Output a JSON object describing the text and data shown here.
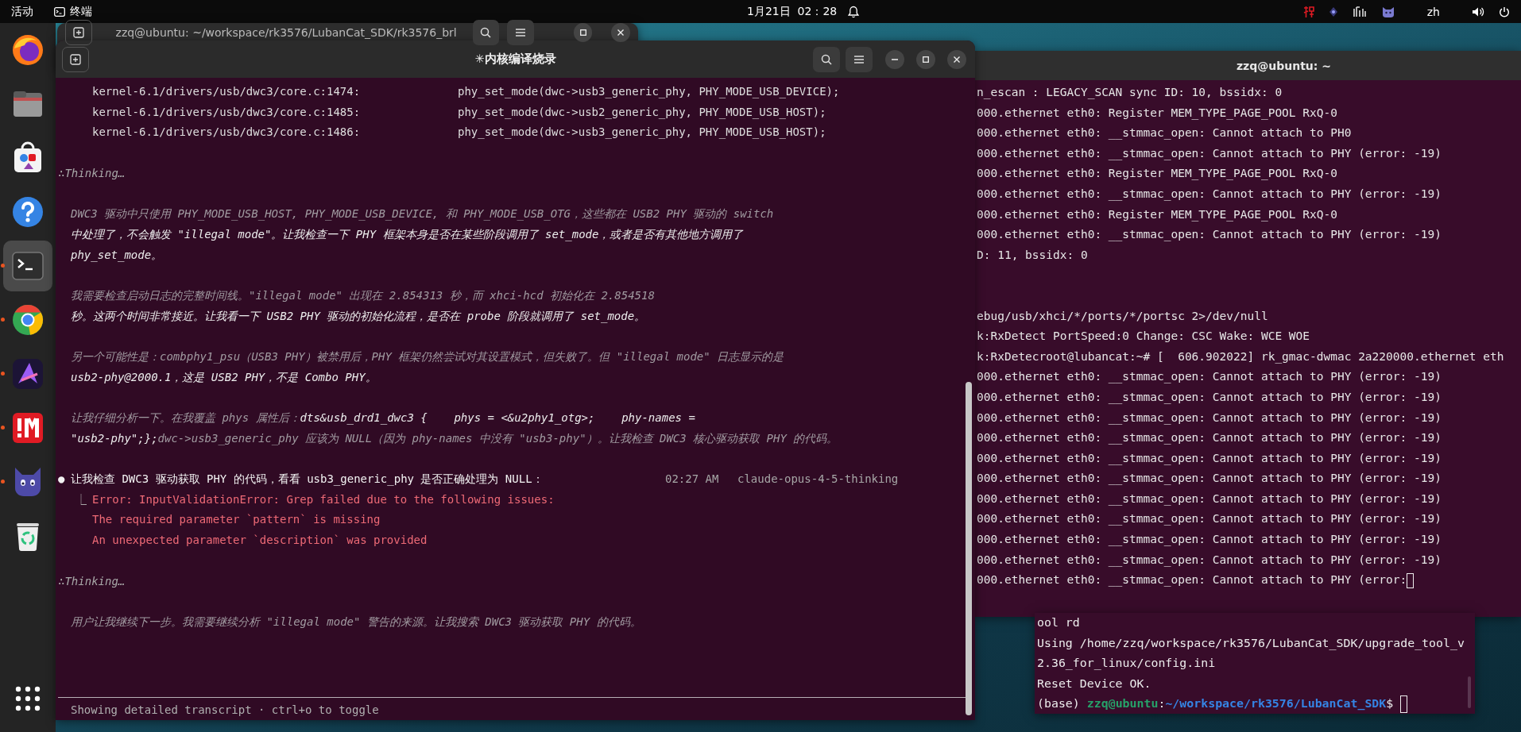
{
  "top_bar": {
    "activities": "活动",
    "app_name": "终端",
    "clock": "1月21日  02：28",
    "language": "zh"
  },
  "dock": {
    "items": [
      {
        "kind": "firefox",
        "running": false,
        "selected": false
      },
      {
        "kind": "files",
        "running": false,
        "selected": false
      },
      {
        "kind": "software",
        "running": false,
        "selected": false
      },
      {
        "kind": "help",
        "running": false,
        "selected": false
      },
      {
        "kind": "terminal",
        "running": true,
        "selected": true
      },
      {
        "kind": "chrome",
        "running": true,
        "selected": false
      },
      {
        "kind": "arrow_app",
        "running": true,
        "selected": false
      },
      {
        "kind": "bang_app",
        "running": true,
        "selected": false
      },
      {
        "kind": "cat",
        "running": true,
        "selected": false
      },
      {
        "kind": "trash",
        "running": false,
        "selected": false
      },
      {
        "kind": "grid",
        "running": false,
        "selected": false
      }
    ]
  },
  "back_window": {
    "title": "zzq@ubuntu: ~/workspace/rk3576/LubanCat_SDK/rk3576_brl"
  },
  "main_window": {
    "title": "✳内核编译烧录",
    "transcript": [
      {
        "kind": "code",
        "path": "kernel-6.1/drivers/usb/dwc3/core.c:1474:",
        "call": "phy_set_mode(dwc->usb3_generic_phy, PHY_MODE_USB_DEVICE);"
      },
      {
        "kind": "code",
        "path": "kernel-6.1/drivers/usb/dwc3/core.c:1485:",
        "call": "phy_set_mode(dwc->usb2_generic_phy, PHY_MODE_USB_HOST);"
      },
      {
        "kind": "code",
        "path": "kernel-6.1/drivers/usb/dwc3/core.c:1486:",
        "call": "phy_set_mode(dwc->usb3_generic_phy, PHY_MODE_USB_HOST);"
      },
      {
        "kind": "thinking",
        "text": "∴Thinking…"
      },
      {
        "kind": "para",
        "lines": [
          [
            {
              "text": "DWC3 驱动中只使用 PHY_MODE_USB_HOST, PHY_MODE_USB_DEVICE, 和 PHY_MODE_USB_OTG，这些都在 USB2 PHY 驱动的 switch",
              "dim": true
            }
          ],
          [
            {
              "text": "中处理了，不会触发 \"illegal mode\"。让我检查一下 PHY 框架本身是否在某些阶段调用了 set_mode，或者是否有其他地方调用了",
              "dim": false
            }
          ],
          [
            {
              "text": "phy_set_mode。",
              "dim": false
            }
          ]
        ]
      },
      {
        "kind": "para",
        "lines": [
          [
            {
              "text": "我需要检查启动日志的完整时间线。\"illegal mode\" 出现在 2.854313 秒，而 xhci-hcd 初始化在 2.854518",
              "dim": true
            }
          ],
          [
            {
              "text": "秒。这两个时间非常接近。让我看一下 USB2 PHY 驱动的初始化流程，是否在 probe 阶段就调用了 set_mode。",
              "dim": false
            }
          ]
        ]
      },
      {
        "kind": "para",
        "lines": [
          [
            {
              "text": "另一个可能性是：combphy1_psu（USB3 PHY）被禁用后，PHY 框架仍然尝试对其设置模式，但失败了。但 \"illegal mode\" 日志显示的是",
              "dim": true
            }
          ],
          [
            {
              "text": "usb2-phy@2000.1，这是 USB2 PHY，不是 Combo PHY。",
              "dim": false
            }
          ]
        ]
      },
      {
        "kind": "para",
        "lines": [
          [
            {
              "text": "让我仔细分析一下。在我覆盖 phys 属性后：",
              "dim": true
            },
            {
              "text": "dts&usb_drd1_dwc3 {    phys = <&u2phy1_otg>;    phy-names =",
              "dim": false
            }
          ],
          [
            {
              "text": "\"usb2-phy\";};",
              "dim": false
            },
            {
              "text": "dwc->usb3_generic_phy 应该为 NULL（因为 phy-names 中没有 \"usb3-phy\"）。让我检查 DWC3 核心驱动获取 PHY 的代码。",
              "dim": true
            }
          ]
        ]
      },
      {
        "kind": "message",
        "marker": "●",
        "text": "让我检查 DWC3 驱动获取 PHY 的代码，看看 usb3_generic_phy 是否正确处理为 NULL：",
        "time": "02:27 AM",
        "model": "claude-opus-4-5-thinking"
      },
      {
        "kind": "error",
        "marker": "⎿",
        "lines": [
          "Error: InputValidationError: Grep failed due to the following issues:",
          "The required parameter `pattern` is missing",
          "An unexpected parameter `description` was provided"
        ]
      },
      {
        "kind": "thinking",
        "text": "∴Thinking…"
      },
      {
        "kind": "para",
        "lines": [
          [
            {
              "text": "用户让我继续下一步。我需要继续分析 \"illegal mode\" 警告的来源。让我搜索 DWC3 驱动获取 PHY 的代码。",
              "dim": true
            }
          ]
        ]
      }
    ],
    "footer": "Showing detailed transcript · ctrl+o to toggle"
  },
  "right_terminal": {
    "title": "zzq@ubuntu: ~",
    "lines": [
      {
        "text": "n_escan : LEGACY_SCAN sync ID: 10, bssidx: 0",
        "cursor": false
      },
      {
        "text": "000.ethernet eth0: Register MEM_TYPE_PAGE_POOL RxQ-0",
        "cursor": false
      },
      {
        "text": "000.ethernet eth0: __stmmac_open: Cannot attach to PH0",
        "cursor": false
      },
      {
        "text": "000.ethernet eth0: __stmmac_open: Cannot attach to PHY (error: -19)",
        "cursor": false
      },
      {
        "text": "000.ethernet eth0: Register MEM_TYPE_PAGE_POOL RxQ-0",
        "cursor": false
      },
      {
        "text": "000.ethernet eth0: __stmmac_open: Cannot attach to PHY (error: -19)",
        "cursor": false
      },
      {
        "text": "000.ethernet eth0: Register MEM_TYPE_PAGE_POOL RxQ-0",
        "cursor": false
      },
      {
        "text": "000.ethernet eth0: __stmmac_open: Cannot attach to PHY (error: -19)",
        "cursor": false
      },
      {
        "text": "D: 11, bssidx: 0",
        "cursor": false
      },
      {
        "cursor": false
      },
      {
        "cursor": false
      },
      {
        "text": "ebug/usb/xhci/*/ports/*/portsc 2>/dev/null",
        "cursor": false
      },
      {
        "text": "k:RxDetect PortSpeed:0 Change: CSC Wake: WCE WOE",
        "cursor": false
      },
      {
        "text": "k:RxDetecroot@lubancat:~# [  606.902022] rk_gmac-dwmac 2a220000.ethernet eth",
        "cursor": false
      },
      {
        "text": "000.ethernet eth0: __stmmac_open: Cannot attach to PHY (error: -19)",
        "cursor": false
      },
      {
        "text": "000.ethernet eth0: __stmmac_open: Cannot attach to PHY (error: -19)",
        "cursor": false
      },
      {
        "text": "000.ethernet eth0: __stmmac_open: Cannot attach to PHY (error: -19)",
        "cursor": false
      },
      {
        "text": "000.ethernet eth0: __stmmac_open: Cannot attach to PHY (error: -19)",
        "cursor": false
      },
      {
        "text": "000.ethernet eth0: __stmmac_open: Cannot attach to PHY (error: -19)",
        "cursor": false
      },
      {
        "text": "000.ethernet eth0: __stmmac_open: Cannot attach to PHY (error: -19)",
        "cursor": false
      },
      {
        "text": "000.ethernet eth0: __stmmac_open: Cannot attach to PHY (error: -19)",
        "cursor": false
      },
      {
        "text": "000.ethernet eth0: __stmmac_open: Cannot attach to PHY (error: -19)",
        "cursor": false
      },
      {
        "text": "000.ethernet eth0: __stmmac_open: Cannot attach to PHY (error: -19)",
        "cursor": false
      },
      {
        "text": "000.ethernet eth0: __stmmac_open: Cannot attach to PHY (error: -19)",
        "cursor": false
      },
      {
        "text": "000.ethernet eth0: __stmmac_open: Cannot attach to PHY (error:",
        "cursor": true
      }
    ]
  },
  "bottom_terminal": {
    "lines": [
      "ool rd",
      "Using /home/zzq/workspace/rk3576/LubanCat_SDK/upgrade_tool_v",
      "2.36_for_linux/config.ini",
      "Reset Device OK."
    ],
    "prompt": {
      "env": "(base) ",
      "user_host": "zzq@ubuntu",
      "separator": ":",
      "path": "~/workspace/rk3576/LubanCat_SDK",
      "symbol": "$"
    }
  }
}
